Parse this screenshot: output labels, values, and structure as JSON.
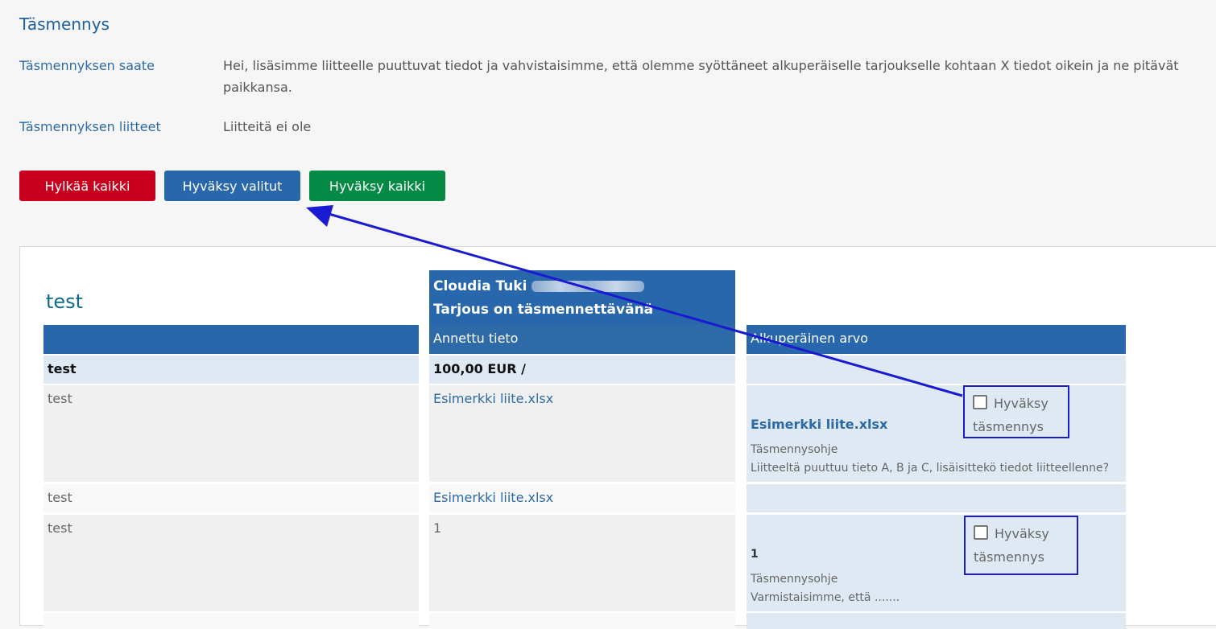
{
  "section": {
    "title": "Täsmennys",
    "saate_label": "Täsmennyksen saate",
    "saate_text": "Hei, lisäsimme liitteelle puuttuvat tiedot ja vahvistaisimme, että olemme syöttäneet alkuperäiselle tarjoukselle kohtaan X tiedot oikein ja ne pitävät paikkansa.",
    "liitteet_label": "Täsmennyksen liitteet",
    "liitteet_text": "Liitteitä ei ole"
  },
  "buttons": {
    "reject_all": "Hylkää kaikki",
    "accept_selected": "Hyväksy valitut",
    "accept_all": "Hyväksy kaikki"
  },
  "table": {
    "title": "test",
    "supplier": "Cloudia Tuki",
    "status": "Tarjous on täsmennettävänä",
    "col_given": "Annettu tieto",
    "col_original": "Alkuperäinen arvo",
    "rows": [
      {
        "label": "test",
        "given": "100,00 EUR /"
      },
      {
        "label": "test",
        "given": "Esimerkki liite.xlsx",
        "orig_value": "Esimerkki liite.xlsx",
        "ohje_label": "Täsmennysohje",
        "ohje_text": "Liitteeltä puuttuu tieto A, B ja C, lisäisittekö tiedot liitteellenne?",
        "accept": "Hyväksy täsmennys"
      },
      {
        "label": "test",
        "given": "Esimerkki liite.xlsx"
      },
      {
        "label": "test",
        "given": "1",
        "orig_value": "1",
        "ohje_label": "Täsmennysohje",
        "ohje_text": "Varmistaisimme, että .......",
        "accept": "Hyväksy täsmennys"
      }
    ]
  },
  "colors": {
    "primary": "#2867ac",
    "danger": "#c8001e",
    "success": "#058a45",
    "annotation": "#1a1ad0"
  }
}
